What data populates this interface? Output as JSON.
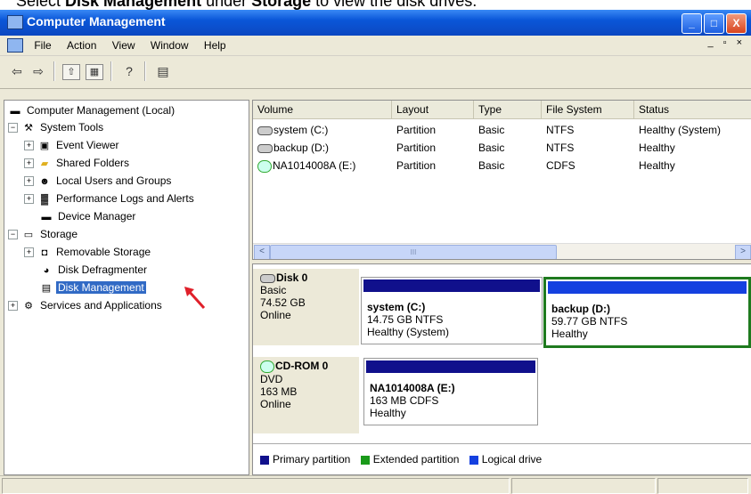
{
  "caption": {
    "pre": "Select ",
    "bold1": "Disk Management",
    "mid": " under ",
    "bold2": "Storage",
    "post": " to view the disk drives."
  },
  "window": {
    "title": "Computer Management",
    "min": "_",
    "max": "□",
    "close": "X",
    "mdi_controls": "_ ▫ ×"
  },
  "menu": {
    "file": "File",
    "action": "Action",
    "view": "View",
    "window": "Window",
    "help": "Help"
  },
  "toolbar": {
    "back": "⇦",
    "forward": "⇨",
    "up": "⇧",
    "tree": "▦",
    "help": "?",
    "props": "▤"
  },
  "tree": [
    {
      "name": "Computer Management (Local)",
      "level": 0,
      "expander": "",
      "icon": "computer-icon",
      "glyph": "▬"
    },
    {
      "name": "System Tools",
      "level": 1,
      "expander": "−",
      "icon": "tools-icon",
      "glyph": "⚒"
    },
    {
      "name": "Event Viewer",
      "level": 2,
      "expander": "+",
      "icon": "event-viewer-icon",
      "glyph": "▣"
    },
    {
      "name": "Shared Folders",
      "level": 2,
      "expander": "+",
      "icon": "folder-icon",
      "glyph": "▰"
    },
    {
      "name": "Local Users and Groups",
      "level": 2,
      "expander": "+",
      "icon": "users-icon",
      "glyph": "☻"
    },
    {
      "name": "Performance Logs and Alerts",
      "level": 2,
      "expander": "+",
      "icon": "performance-icon",
      "glyph": "▓"
    },
    {
      "name": "Device Manager",
      "level": 2,
      "expander": "",
      "icon": "device-manager-icon",
      "glyph": "▬"
    },
    {
      "name": "Storage",
      "level": 1,
      "expander": "−",
      "icon": "storage-icon",
      "glyph": "▭"
    },
    {
      "name": "Removable Storage",
      "level": 2,
      "expander": "+",
      "icon": "removable-storage-icon",
      "glyph": "◘"
    },
    {
      "name": "Disk Defragmenter",
      "level": 2,
      "expander": "",
      "icon": "defrag-icon",
      "glyph": "◕"
    },
    {
      "name": "Disk Management",
      "level": 2,
      "expander": "",
      "icon": "disk-management-icon",
      "glyph": "▤",
      "selected": true
    },
    {
      "name": "Services and Applications",
      "level": 1,
      "expander": "+",
      "icon": "services-icon",
      "glyph": "⚙"
    }
  ],
  "columns": [
    "Volume",
    "Layout",
    "Type",
    "File System",
    "Status"
  ],
  "volumes": [
    {
      "volume": "system (C:)",
      "layout": "Partition",
      "type": "Basic",
      "fs": "NTFS",
      "status": "Healthy (System)",
      "icon": "hard-drive-icon"
    },
    {
      "volume": "backup (D:)",
      "layout": "Partition",
      "type": "Basic",
      "fs": "NTFS",
      "status": "Healthy",
      "icon": "hard-drive-icon"
    },
    {
      "volume": "NA1014008A (E:)",
      "layout": "Partition",
      "type": "Basic",
      "fs": "CDFS",
      "status": "Healthy",
      "icon": "cd-drive-icon"
    }
  ],
  "scroll": {
    "left": "<",
    "right": ">",
    "thumb": "III"
  },
  "disks": [
    {
      "name": "Disk 0",
      "kind": "Basic",
      "size": "74.52 GB",
      "state": "Online",
      "partitions": [
        {
          "name": "system  (C:)",
          "detail": "14.75 GB NTFS",
          "status": "Healthy (System)"
        },
        {
          "name": "backup  (D:)",
          "detail": "59.77 GB NTFS",
          "status": "Healthy"
        }
      ]
    },
    {
      "name": "CD-ROM 0",
      "kind": "DVD",
      "size": "163 MB",
      "state": "Online",
      "partitions": [
        {
          "name": "NA1014008A  (E:)",
          "detail": "163 MB CDFS",
          "status": "Healthy"
        }
      ]
    }
  ],
  "legend": [
    {
      "label": "Primary partition",
      "color": "#10108c"
    },
    {
      "label": "Extended partition",
      "color": "#1a9a1a"
    },
    {
      "label": "Logical drive",
      "color": "#1440e0"
    }
  ],
  "colors": {
    "titlebar": "#0a56d8",
    "selection": "#316ac5",
    "partition_bar": "#10108c",
    "selected_partition_border": "#1e7a1e",
    "annotation_arrow": "#e0202a"
  }
}
